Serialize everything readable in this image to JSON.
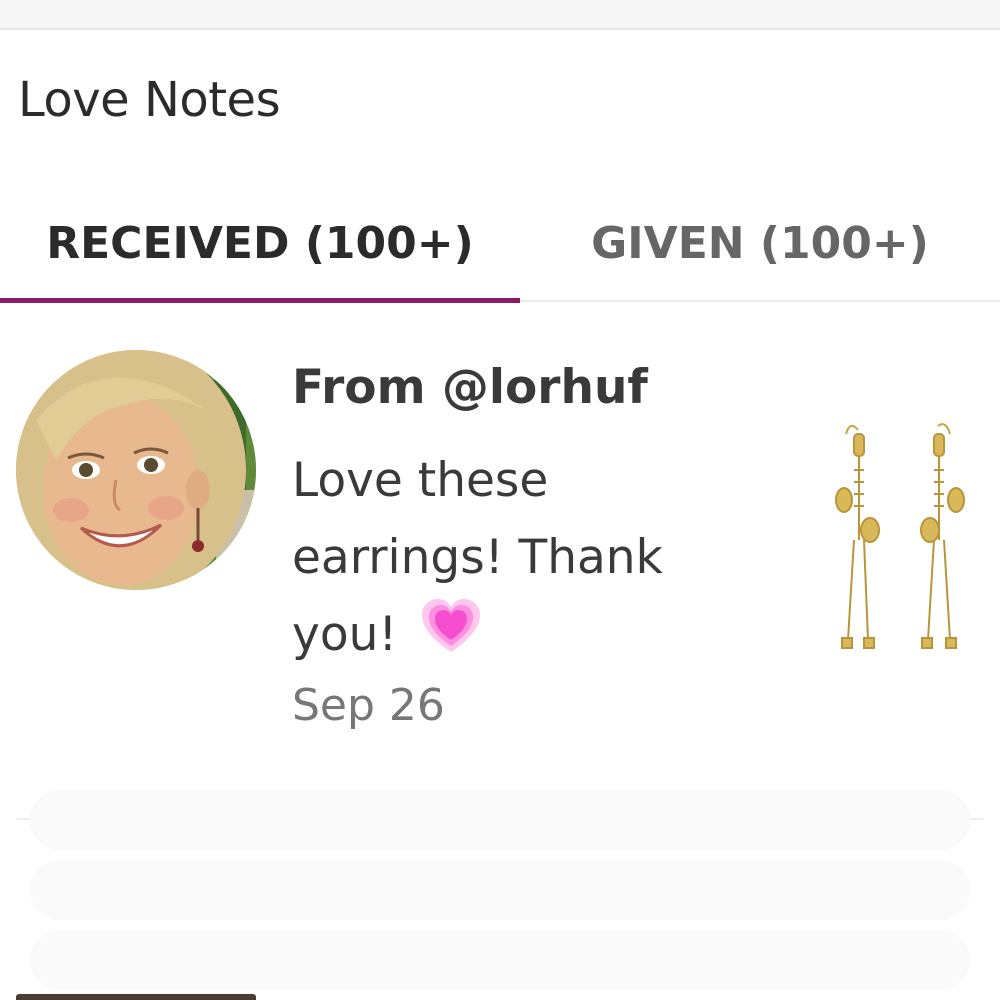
{
  "header": {
    "title": "Love Notes"
  },
  "tabs": [
    {
      "label": "RECEIVED (100+)",
      "active": true
    },
    {
      "label": "GIVEN (100+)",
      "active": false
    }
  ],
  "accent_color": "#8c1a6a",
  "notes": [
    {
      "sender": "From @lorhuf",
      "message": "Love these earrings! Thank you!",
      "emoji": "growing-heart-icon",
      "date": "Sep 26",
      "product_image": "skeleton-earrings-image",
      "avatar": "user-avatar"
    }
  ]
}
